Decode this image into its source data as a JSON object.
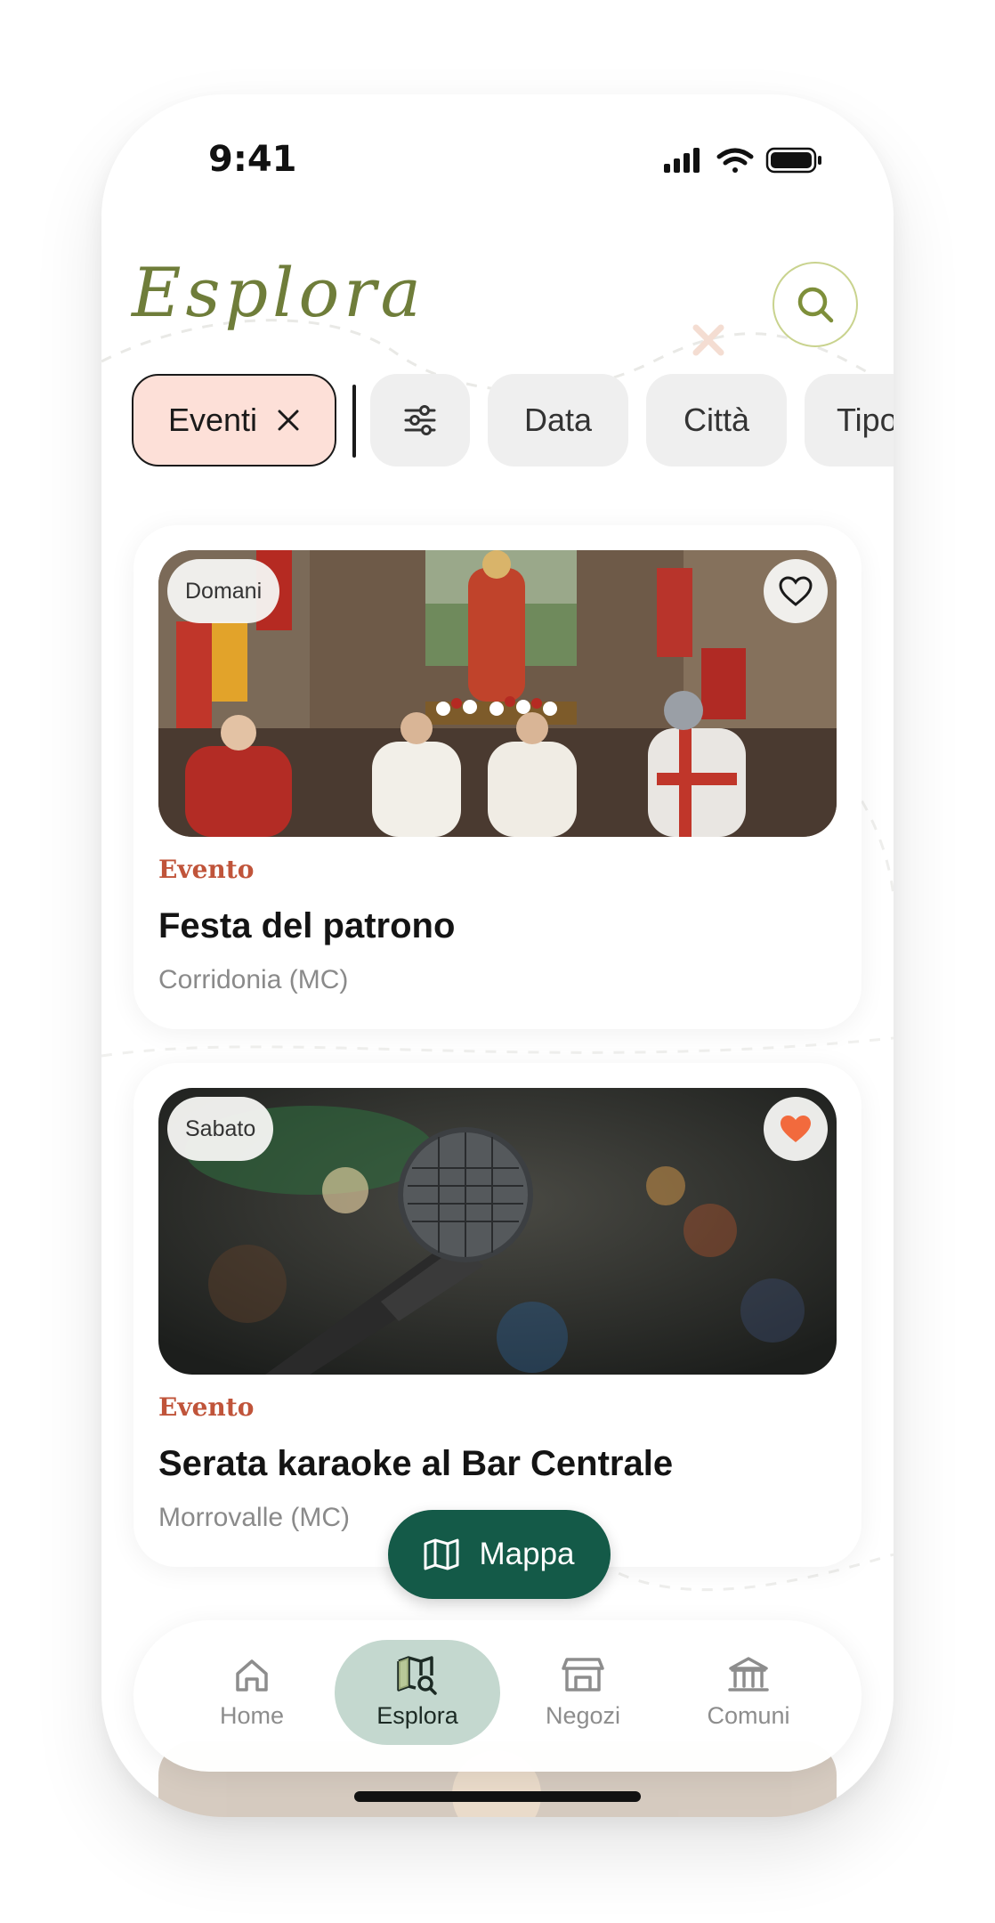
{
  "status_bar": {
    "time": "9:41"
  },
  "header": {
    "title": "Esplora"
  },
  "filters": {
    "active": {
      "label": "Eventi"
    },
    "chips": [
      "Data",
      "Città",
      "Tipo"
    ]
  },
  "cards": [
    {
      "badge": "Domani",
      "category": "Evento",
      "title": "Festa del patrono",
      "location": "Corridonia (MC)",
      "favorited": false
    },
    {
      "badge": "Sabato",
      "category": "Evento",
      "title": "Serata karaoke al Bar Centrale",
      "location": "Morrovalle (MC)",
      "favorited": true
    }
  ],
  "map_button": {
    "label": "Mappa"
  },
  "nav": {
    "items": [
      {
        "label": "Home",
        "icon": "home-icon"
      },
      {
        "label": "Esplora",
        "icon": "map-search-icon"
      },
      {
        "label": "Negozi",
        "icon": "store-icon"
      },
      {
        "label": "Comuni",
        "icon": "town-hall-icon"
      }
    ],
    "active": "Esplora"
  },
  "colors": {
    "accent_green": "#145a48",
    "title_olive": "#6f7d3a",
    "category_red": "#c0543a",
    "active_chip_bg": "#fde0d8",
    "active_tab_bg": "#c4d8cf",
    "heart_orange": "#f26a3d"
  }
}
